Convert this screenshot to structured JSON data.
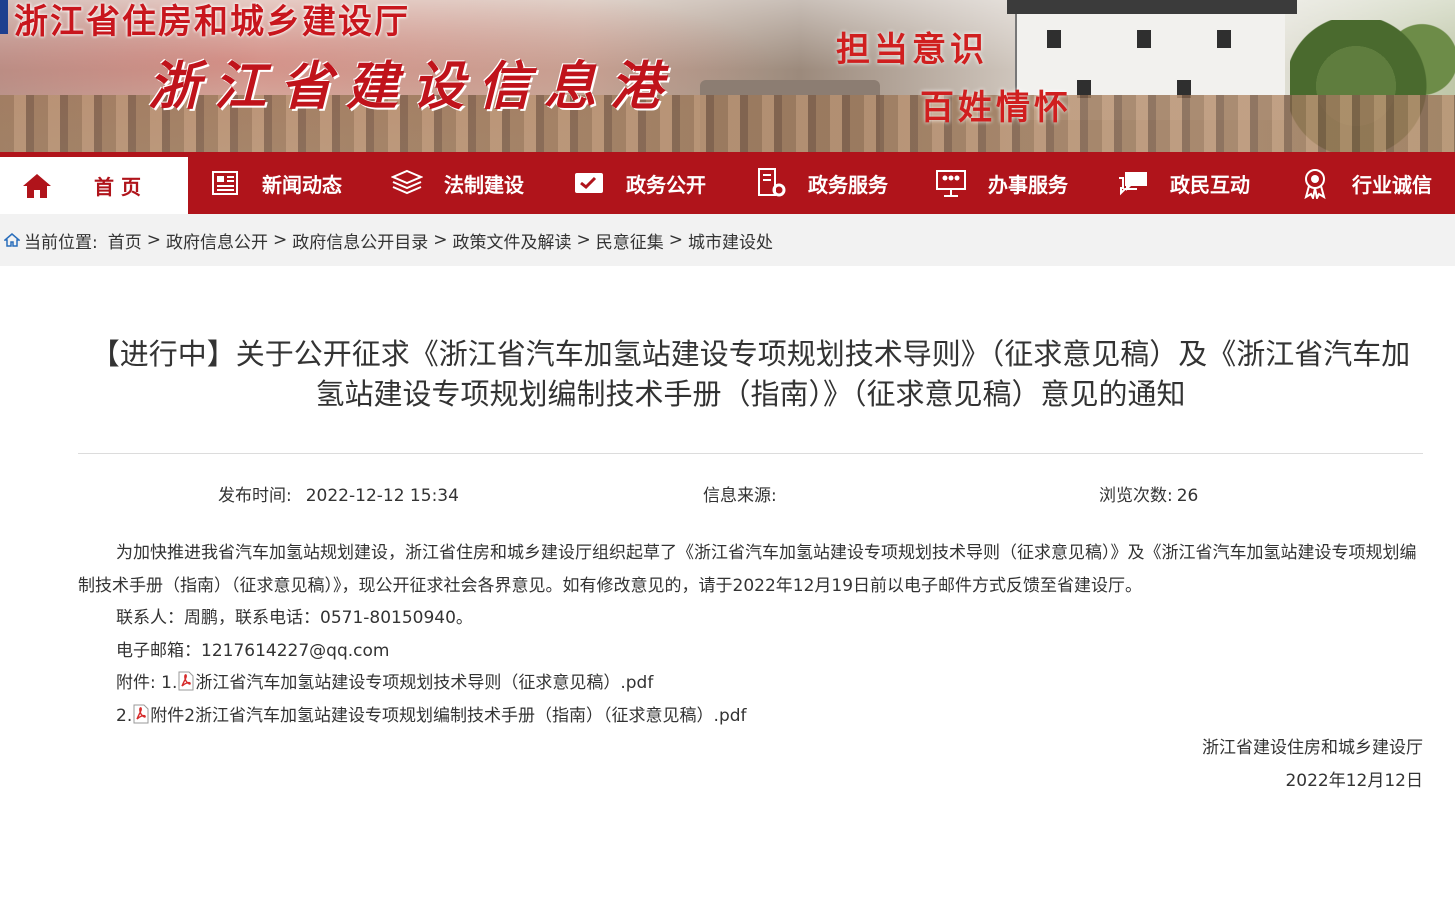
{
  "banner": {
    "dept_title": "浙江省住房和城乡建设厅",
    "site_title": "浙江省建设信息港",
    "slogan_line1": "担当意识",
    "slogan_line2": "百姓情怀"
  },
  "nav": {
    "items": [
      {
        "label": "首 页",
        "icon": "home-icon"
      },
      {
        "label": "新闻动态",
        "icon": "newspaper-icon"
      },
      {
        "label": "法制建设",
        "icon": "layers-icon"
      },
      {
        "label": "政务公开",
        "icon": "document-check-icon"
      },
      {
        "label": "政务服务",
        "icon": "service-gear-icon"
      },
      {
        "label": "办事服务",
        "icon": "people-board-icon"
      },
      {
        "label": "政民互动",
        "icon": "chat-icon"
      },
      {
        "label": "行业诚信",
        "icon": "award-icon"
      }
    ],
    "active_color": "#b0141b"
  },
  "breadcrumb": {
    "prefix": "当前位置:",
    "items": [
      "首页",
      "政府信息公开",
      "政府信息公开目录",
      "政策文件及解读",
      "民意征集",
      "城市建设处"
    ],
    "separator": ">"
  },
  "article": {
    "title": "【进行中】关于公开征求《浙江省汽车加氢站建设专项规划技术导则》（征求意见稿）及《浙江省汽车加氢站建设专项规划编制技术手册（指南）》（征求意见稿）意见的通知",
    "meta": {
      "publish_label": "发布时间:",
      "publish_value": "2022-12-12 15:34",
      "source_label": "信息来源:",
      "source_value": "",
      "views_label": "浏览次数:",
      "views_value": "26"
    },
    "paragraph1": "为加快推进我省汽车加氢站规划建设，浙江省住房和城乡建设厅组织起草了《浙江省汽车加氢站建设专项规划技术导则（征求意见稿）》及《浙江省汽车加氢站建设专项规划编制技术手册（指南）（征求意见稿）》，现公开征求社会各界意见。如有修改意见的，请于2022年12月19日前以电子邮件方式反馈至省建设厅。",
    "contact": "联系人：周鹏，联系电话：0571-80150940。",
    "email": "电子邮箱：1217614227@qq.com",
    "attachments_label": "附件: 1.",
    "attachment1": "浙江省汽车加氢站建设专项规划技术导则（征求意见稿）.pdf",
    "attachment2_prefix": "2.",
    "attachment2": "附件2浙江省汽车加氢站建设专项规划编制技术手册（指南）（征求意见稿）.pdf",
    "signature_org": "浙江省建设住房和城乡建设厅",
    "signature_date": "2022年12月12日"
  }
}
